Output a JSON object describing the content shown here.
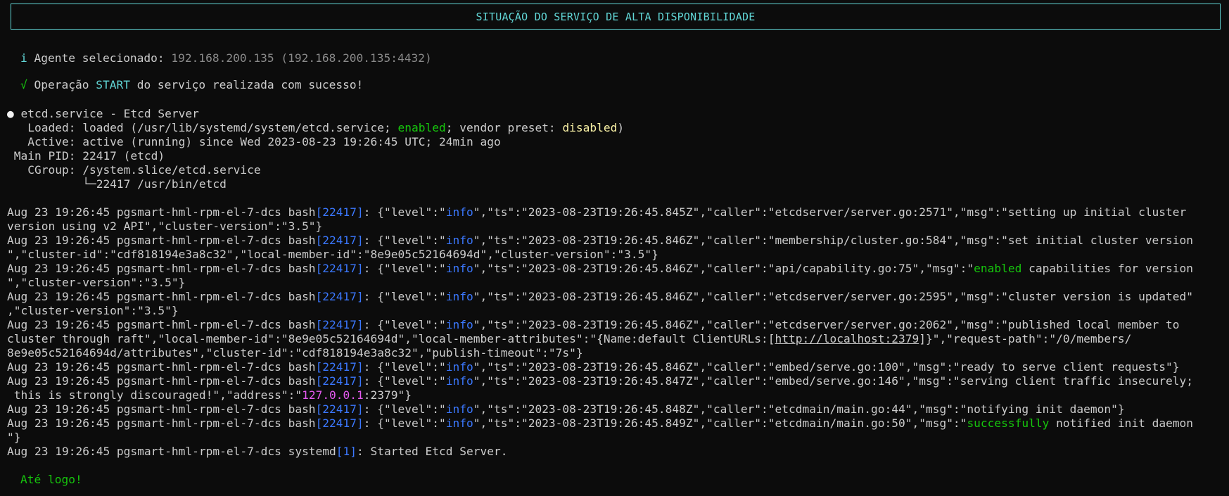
{
  "header": {
    "title": "SITUAÇÃO DO SERVIÇO DE ALTA DISPONIBILIDADE"
  },
  "agent": {
    "icon": "i",
    "label": " Agente selecionado: ",
    "value": "192.168.200.135 (192.168.200.135:4432)"
  },
  "operation": {
    "icon": "√",
    "prefix": " Operação ",
    "keyword": "START",
    "suffix": " do serviço realizada com sucesso!"
  },
  "status": {
    "bullet": "●",
    "unit": " etcd.service - Etcd Server",
    "loaded_prefix": "   Loaded: loaded (/usr/lib/systemd/system/etcd.service; ",
    "loaded_enabled": "enabled",
    "loaded_mid": "; vendor preset: ",
    "loaded_disabled": "disabled",
    "loaded_suffix": ")",
    "active": "   Active: active (running) since Wed 2023-08-23 19:26:45 UTC; 24min ago",
    "mainpid": " Main PID: 22417 (etcd)",
    "cgroup": "   CGroup: /system.slice/etcd.service",
    "cgroup_child": "           └─22417 /usr/bin/etcd"
  },
  "logs": {
    "prefix": "Aug 23 19:26:45 pgsmart-hml-rpm-el-7-dcs bash",
    "pid": "[22417]",
    "info": "info",
    "l1a": ": {\"level\":\"",
    "l1b": "\",\"ts\":\"2023-08-23T19:26:45.845Z\",\"caller\":\"etcdserver/server.go:2571\",\"msg\":\"setting up initial cluster",
    "l1c": "version using v2 API\",\"cluster-version\":\"3.5\"}",
    "l2b": "\",\"ts\":\"2023-08-23T19:26:45.846Z\",\"caller\":\"membership/cluster.go:584\",\"msg\":\"set initial cluster version",
    "l2c": "\",\"cluster-id\":\"cdf818194e3a8c32\",\"local-member-id\":\"8e9e05c52164694d\",\"cluster-version\":\"3.5\"}",
    "l3b": "\",\"ts\":\"2023-08-23T19:26:45.846Z\",\"caller\":\"api/capability.go:75\",\"msg\":\"",
    "l3enabled": "enabled",
    "l3d": " capabilities for version",
    "l3c": "\",\"cluster-version\":\"3.5\"}",
    "l4b": "\",\"ts\":\"2023-08-23T19:26:45.846Z\",\"caller\":\"etcdserver/server.go:2595\",\"msg\":\"cluster version is updated\"",
    "l4c": ",\"cluster-version\":\"3.5\"}",
    "l5b": "\",\"ts\":\"2023-08-23T19:26:45.846Z\",\"caller\":\"etcdserver/server.go:2062\",\"msg\":\"published local member to",
    "l5c1": "cluster through raft\",\"local-member-id\":\"8e9e05c52164694d\",\"local-member-attributes\":\"{Name:default ClientURLs:[",
    "l5link": "http://localhost:2379",
    "l5c2": "]}\",\"request-path\":\"/0/members/",
    "l5d": "8e9e05c52164694d/attributes\",\"cluster-id\":\"cdf818194e3a8c32\",\"publish-timeout\":\"7s\"}",
    "l6b": "\",\"ts\":\"2023-08-23T19:26:45.846Z\",\"caller\":\"embed/serve.go:100\",\"msg\":\"ready to serve client requests\"}",
    "l7b": "\",\"ts\":\"2023-08-23T19:26:45.847Z\",\"caller\":\"embed/serve.go:146\",\"msg\":\"serving client traffic insecurely;",
    "l7c1": " this is strongly discouraged!\",\"address\":\"",
    "l7ip": "127.0.0.1",
    "l7c2": ":2379\"}",
    "l8b": "\",\"ts\":\"2023-08-23T19:26:45.848Z\",\"caller\":\"etcdmain/main.go:44\",\"msg\":\"notifying init daemon\"}",
    "l9b": "\",\"ts\":\"2023-08-23T19:26:45.849Z\",\"caller\":\"etcdmain/main.go:50\",\"msg\":\"",
    "l9succ": "successfully",
    "l9d": " notified init daemon",
    "l9c": "\"}",
    "sys_prefix": "Aug 23 19:26:45 pgsmart-hml-rpm-el-7-dcs systemd",
    "sys_pid": "[1]",
    "sys_msg": ": Started Etcd Server."
  },
  "footer": {
    "bye": "Até logo!"
  }
}
